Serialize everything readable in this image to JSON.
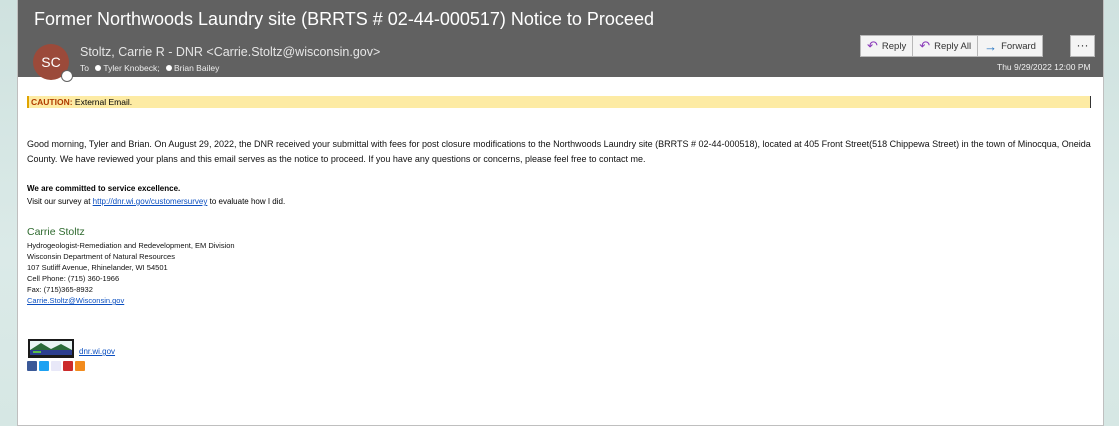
{
  "email": {
    "subject": "Former Northwoods Laundry site (BRRTS # 02-44-000517) Notice to Proceed",
    "avatar_initials": "SC",
    "sender": "Stoltz, Carrie R - DNR <Carrie.Stoltz@wisconsin.gov>",
    "to_label": "To",
    "recipients": [
      "Tyler Knobeck;",
      "Brian Bailey"
    ],
    "datetime": "Thu 9/29/2022 12:00 PM",
    "actions": {
      "reply": "Reply",
      "reply_all": "Reply All",
      "forward": "Forward",
      "more": "···"
    },
    "caution_label": "CAUTION:",
    "caution_text": " External Email.",
    "body": "Good morning, Tyler and Brian.  On August 29, 2022, the DNR received your submittal with fees for post closure modifications to the Northwoods Laundry site (BRRTS # 02-44-000518), located at 405 Front Street(518 Chippewa Street) in the town of Minocqua, Oneida County.  We have reviewed your plans and this email serves as the notice to proceed.  If you have any questions or concerns, please feel free to contact me.",
    "commitment": "We are committed to service excellence.",
    "survey_pre": "Visit our survey at ",
    "survey_link": "http://dnr.wi.gov/customersurvey",
    "survey_post": " to evaluate how I did.",
    "signature": {
      "name": "Carrie Stoltz",
      "title": "Hydrogeologist-Remediation and Redevelopment, EM Division",
      "org": "Wisconsin Department of Natural Resources",
      "address": "107 Sutliff Avenue, Rhinelander, WI 54501",
      "cell": "Cell Phone: (715) 360-1966",
      "fax": "Fax: (715)365-8932",
      "email": "Carrie.Stoltz@Wisconsin.gov"
    },
    "logo_link": "dnr.wi.gov",
    "social_icons": [
      "facebook-icon",
      "twitter-icon",
      "flickr-icon",
      "youtube-icon",
      "rss-icon"
    ]
  },
  "colors": {
    "header_bg": "#616161",
    "caution_bg": "#fdeba4",
    "link": "#0b4fc0",
    "signature_name": "#2e6a2e"
  }
}
